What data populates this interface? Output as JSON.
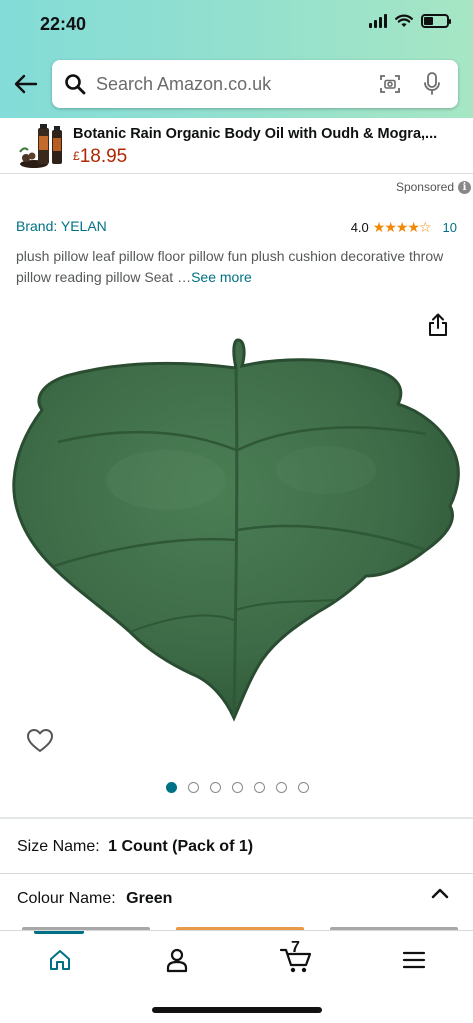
{
  "status_bar": {
    "time": "22:40"
  },
  "search": {
    "placeholder": "Search Amazon.co.uk"
  },
  "ad": {
    "title": "Botanic Rain Organic Body Oil with Oudh & Mogra,...",
    "currency": "£",
    "price": "18.95",
    "sponsored_label": "Sponsored"
  },
  "product": {
    "brand": "Brand: YELAN",
    "rating_value": "4.0",
    "rating_stars": "★★★★☆",
    "rating_fraction": 0.8,
    "review_count": "10",
    "description": "plush pillow leaf pillow floor pillow fun plush cushion decorative throw pillow reading pillow Seat …",
    "see_more": "See more",
    "image_count": 7,
    "active_image": 1
  },
  "options": {
    "size_label": "Size Name:",
    "size_value": "1 Count (Pack of 1)",
    "colour_label": "Colour Name:",
    "colour_value": "Green"
  },
  "bottom_nav": {
    "cart_count": "7",
    "active": "home"
  },
  "colors": {
    "accent": "#007185",
    "price": "#b12704",
    "star": "#f08804",
    "pillow": "#3d6b47"
  },
  "icons": [
    "back-arrow-icon",
    "search-icon",
    "camera-scan-icon",
    "microphone-icon",
    "info-icon",
    "share-icon",
    "heart-icon",
    "home-icon",
    "account-icon",
    "cart-icon",
    "menu-icon",
    "chevron-up-icon"
  ]
}
